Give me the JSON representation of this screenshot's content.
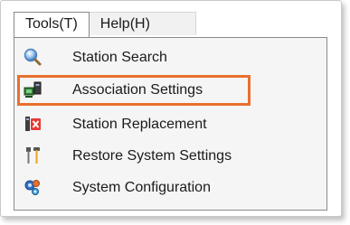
{
  "menubar": {
    "tools_label": "Tools(T)",
    "help_label": "Help(H)"
  },
  "tools_menu": {
    "items": [
      {
        "label": "Station Search",
        "icon": "magnifier-icon"
      },
      {
        "label": "Association Settings",
        "icon": "association-icon",
        "highlighted": true
      },
      {
        "label": "Station Replacement",
        "icon": "station-replace-icon"
      },
      {
        "label": "Restore System Settings",
        "icon": "tools-icon"
      },
      {
        "label": "System Configuration",
        "icon": "system-config-icon"
      }
    ]
  },
  "colors": {
    "highlight_border": "#e8702e",
    "menu_background": "#f5f5f5"
  }
}
